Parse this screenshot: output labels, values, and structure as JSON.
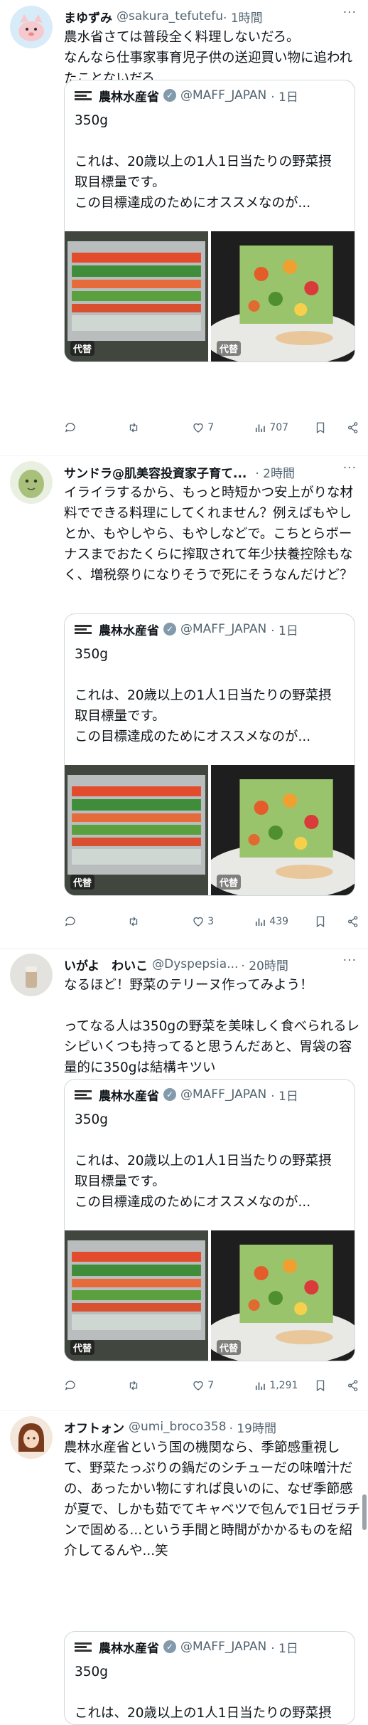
{
  "colors": {
    "text": "#0f1419",
    "secondary": "#536471",
    "border": "#cfd9de",
    "divider": "#eff3f4"
  },
  "quoted": {
    "name": "農林水産省",
    "handle": "@MAFF_JAPAN",
    "time": "· 1日",
    "text": "350g\n\nこれは、20歳以上の1人1日当たりの野菜摂取目標量です。\nこの目標達成のためにオススメなのが...",
    "badge": "代替",
    "logo_icon": "maff-logo-icon",
    "verified_icon": "verified-badge-icon"
  },
  "tweets": [
    {
      "name": "まゆずみ",
      "handle": "@sakura_tefutefu",
      "time": "· 1時間",
      "text": "農水省さては普段全く料理しないだろ。\nなんなら仕事家事育児子供の送迎買い物に追われたことないだろ",
      "replies": "",
      "retweets": "",
      "likes": "7",
      "views": "707"
    },
    {
      "name": "サンドラ@肌美容投資家子育て...",
      "handle": "",
      "time": "· 2時間",
      "text": "イライラするから、もっと時短かつ安上がりな材料でできる料理にしてくれません？例えばもやしとか、もやしやら、もやしなどで。こちとらボーナスまでおたくらに搾取されて年少扶養控除もなく、増税祭りになりそうで死にそうなんだけど？",
      "replies": "",
      "retweets": "",
      "likes": "3",
      "views": "439"
    },
    {
      "name": "いがよ　わいこ",
      "handle": "@Dyspepsia...",
      "time": "· 20時間",
      "text": "なるほど！野菜のテリーヌ作ってみよう！\n\nってなる人は350gの野菜を美味しく食べられるレシピいくつも持ってると思うんだあと、胃袋の容量的に350gは結構キツい",
      "replies": "",
      "retweets": "",
      "likes": "7",
      "views": "1,291"
    },
    {
      "name": "オフトォン",
      "handle": "@umi_broco358",
      "time": "· 19時間",
      "text": "農林水産省という国の機関なら、季節感重視して、野菜たっぷりの鍋だのシチューだの味噌汁だの、あったかい物にすれば良いのに、なぜ季節感が夏で、しかも茹でてキャベツで包んで1日ゼラチンで固める...という手間と時間がかかるものを紹介してるんや...笑"
    }
  ]
}
